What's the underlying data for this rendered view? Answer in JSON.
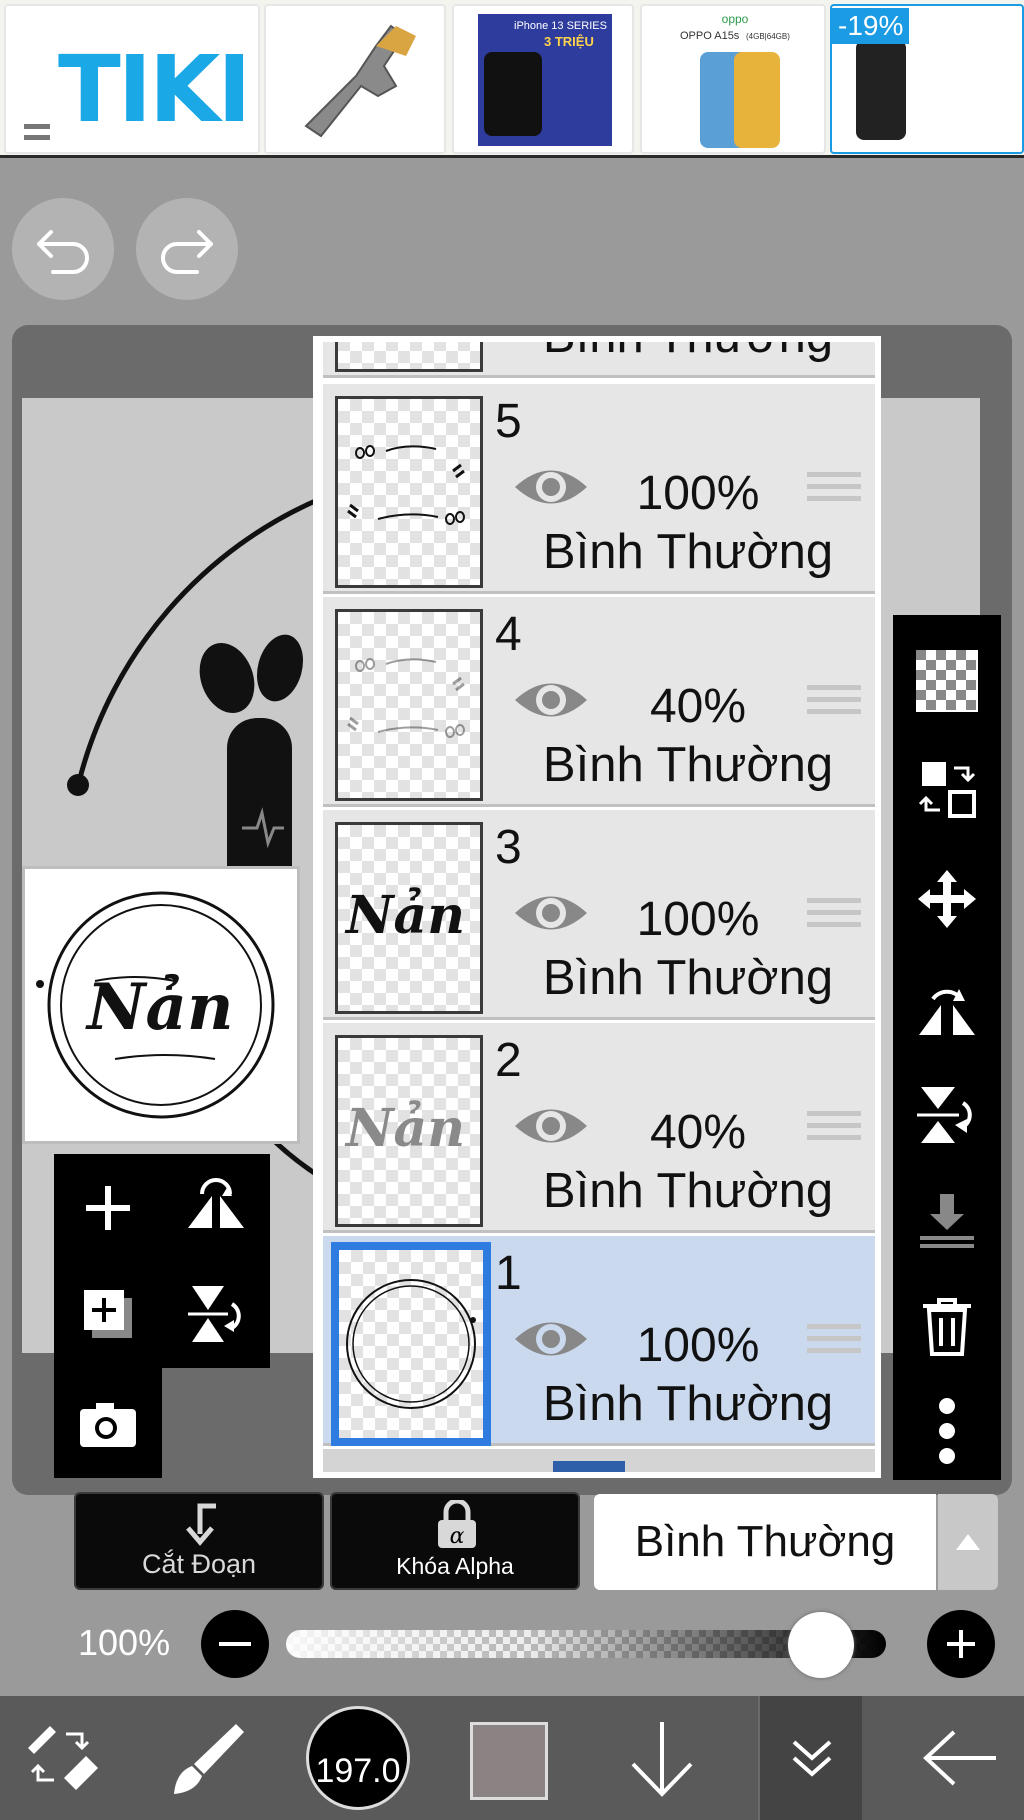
{
  "ad_banner": {
    "logo_text": "TIKI",
    "products": [
      {
        "name": "locking-pliers"
      },
      {
        "name": "iphone-13",
        "title": "iPhone 13 SERIES",
        "subtitle": "3 TRIỆU"
      },
      {
        "name": "oppo-a15s",
        "brand": "oppo",
        "model": "OPPO A15s",
        "spec": "(4GB|64GB)"
      },
      {
        "name": "samsung-note10",
        "discount": "-19%"
      }
    ]
  },
  "history": {
    "undo_icon": "undo-icon",
    "redo_icon": "redo-icon"
  },
  "layers": {
    "partial_top_blend": "Bình Thường",
    "items": [
      {
        "number": "5",
        "opacity": "100%",
        "blend": "Bình Thường",
        "selected": false
      },
      {
        "number": "4",
        "opacity": "40%",
        "blend": "Bình Thường",
        "selected": false
      },
      {
        "number": "3",
        "opacity": "100%",
        "blend": "Bình Thường",
        "selected": false
      },
      {
        "number": "2",
        "opacity": "40%",
        "blend": "Bình Thường",
        "selected": false
      },
      {
        "number": "1",
        "opacity": "100%",
        "blend": "Bình Thường",
        "selected": true
      }
    ]
  },
  "preview": {
    "artwork_text": "Nản"
  },
  "right_tools": [
    "transparency-icon",
    "swap-layer-icon",
    "move-icon",
    "flip-horizontal-icon",
    "flip-vertical-icon",
    "merge-down-icon",
    "trash-icon",
    "more-icon"
  ],
  "left_tools": [
    "add-layer-icon",
    "flip-h-icon",
    "add-copy-icon",
    "flip-v-icon",
    "camera-icon"
  ],
  "layer_controls": {
    "clip_label": "Cắt Đoạn",
    "alpha_lock_label": "Khóa Alpha",
    "blend_mode": "Bình Thường",
    "opacity_label": "100%",
    "opacity_value": 100
  },
  "bottom_bar": {
    "brush_size": "197.0",
    "color": "#8a8283"
  },
  "colors": {
    "accent_blue": "#2e7ce0",
    "selected_row": "#cad9ee",
    "tiki_blue": "#1ba8e6"
  }
}
